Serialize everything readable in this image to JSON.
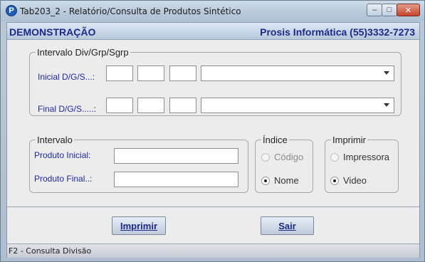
{
  "window": {
    "title": "Tab203_2 - Relatório/Consulta de Produtos Sintético",
    "icon_letter": "P",
    "controls": [
      "minimize",
      "maximize",
      "close"
    ],
    "minimize_glyph": "‒",
    "maximize_glyph": "□",
    "close_glyph": "✕"
  },
  "header": {
    "left": "DEMONSTRAÇÃO",
    "right": "Prosis Informática (55)3332-7273"
  },
  "intervalo_div": {
    "title": "Intervalo Div/Grp/Sgrp",
    "inicial_label": "Inicial  D/G/S...:",
    "final_label": "Final  D/G/S.....:",
    "inicial_values": [
      "",
      "",
      ""
    ],
    "final_values": [
      "",
      "",
      ""
    ],
    "inicial_combo": "",
    "final_combo": ""
  },
  "intervalo": {
    "title": "Intervalo",
    "produto_inicial_label": "Produto Inicial:",
    "produto_final_label": "Produto Final..:",
    "produto_inicial_value": "",
    "produto_final_value": ""
  },
  "indice": {
    "title": "Índice",
    "options": [
      {
        "label": "Código",
        "checked": false
      },
      {
        "label": "Nome",
        "checked": true
      }
    ]
  },
  "imprimir_group": {
    "title": "Imprimir",
    "options": [
      {
        "label": "Impressora",
        "checked": false
      },
      {
        "label": "Video",
        "checked": true
      }
    ]
  },
  "buttons": {
    "imprimir": "Imprimir",
    "sair": "Sair"
  },
  "status": {
    "text": "F2 - Consulta Divisão"
  }
}
